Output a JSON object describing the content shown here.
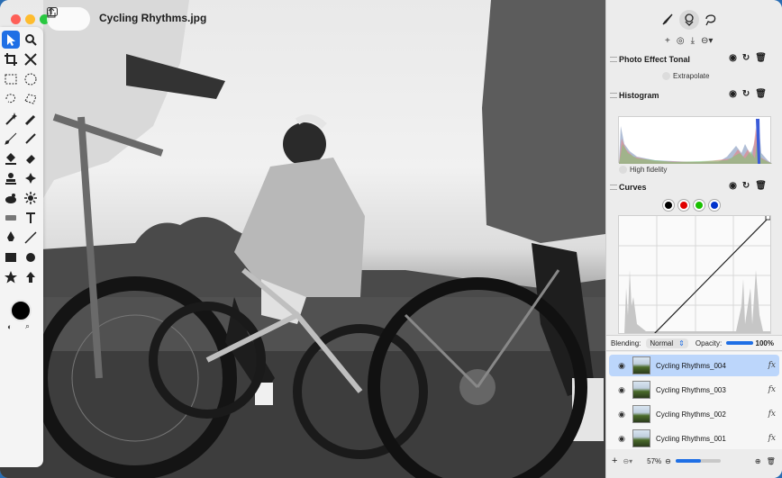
{
  "window": {
    "document_title": "Cycling Rhythms.jpg"
  },
  "toolbar": {
    "active_tool": "select-arrow-icon",
    "primary_color": "#000000",
    "tools": [
      "select-arrow-icon",
      "zoom-icon",
      "crop-icon",
      "transform-icon",
      "rect-select-icon",
      "ellipse-select-icon",
      "lasso-icon",
      "polygon-lasso-icon",
      "magic-wand-icon",
      "quick-select-icon",
      "brush-icon",
      "pencil-icon",
      "fill-icon",
      "eraser-icon",
      "clone-stamp-icon",
      "heal-icon",
      "smudge-icon",
      "sharpen-icon",
      "rectangle-shape-icon",
      "text-icon",
      "pen-icon",
      "line-icon",
      "square-icon",
      "circle-icon",
      "star-icon",
      "arrow-icon"
    ]
  },
  "panel": {
    "top_segments": [
      "brush-mode-icon",
      "layers-style-icon",
      "lasso-mask-icon"
    ],
    "add_row": [
      "+",
      "◎",
      "⤓",
      "⊖▾"
    ],
    "effects": [
      {
        "name": "Photo Effect Tonal",
        "option": "Extrapolate"
      },
      {
        "name": "Histogram",
        "option": "High fidelity"
      },
      {
        "name": "Curves",
        "channels": [
          "#000000",
          "#e00000",
          "#19c000",
          "#0033cc"
        ]
      }
    ],
    "blending": {
      "label": "Blending:",
      "mode": "Normal",
      "opacity_label": "Opacity:",
      "opacity_value": "100%",
      "opacity_fraction": 1.0
    },
    "layers": [
      {
        "name": "Cycling Rhythms_004",
        "selected": true,
        "fx": "fx"
      },
      {
        "name": "Cycling Rhythms_003",
        "selected": false,
        "fx": "fx"
      },
      {
        "name": "Cycling Rhythms_002",
        "selected": false,
        "fx": "fx"
      },
      {
        "name": "Cycling Rhythms_001",
        "selected": false,
        "fx": "fx"
      }
    ],
    "footer": {
      "add": "+",
      "options": "⊖▾",
      "zoom": "57%",
      "zoom_fraction": 0.57
    }
  }
}
